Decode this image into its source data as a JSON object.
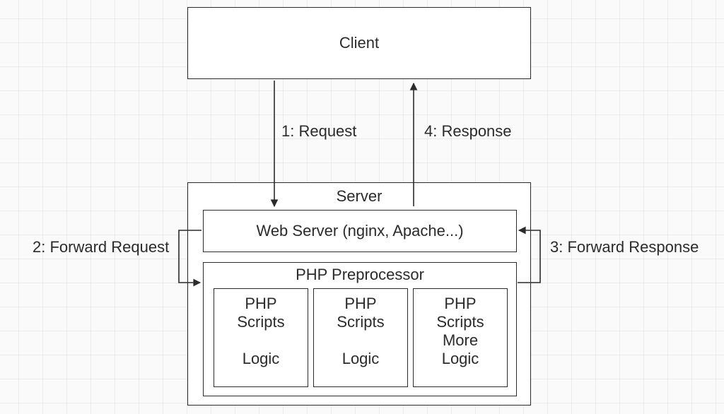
{
  "diagram": {
    "client": {
      "label": "Client"
    },
    "server": {
      "label": "Server",
      "web_server": {
        "label": "Web Server (nginx, Apache...)"
      },
      "php": {
        "label": "PHP Preprocessor",
        "scripts": [
          {
            "line1": "PHP",
            "line2": "Scripts",
            "line3": "",
            "line4": "Logic"
          },
          {
            "line1": "PHP",
            "line2": "Scripts",
            "line3": "",
            "line4": "Logic"
          },
          {
            "line1": "PHP",
            "line2": "Scripts",
            "line3": "More",
            "line4": "Logic"
          }
        ]
      }
    },
    "flows": {
      "request": {
        "label": "1: Request"
      },
      "forward_request": {
        "label": "2: Forward Request"
      },
      "forward_response": {
        "label": "3: Forward Response"
      },
      "response": {
        "label": "4: Response"
      }
    }
  }
}
